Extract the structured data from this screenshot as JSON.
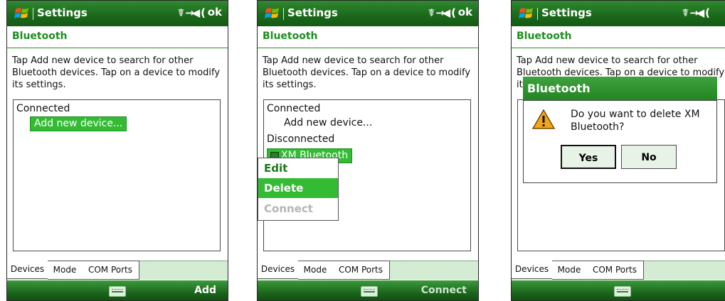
{
  "screens": [
    {
      "title": "Settings",
      "ok": "ok",
      "header": "Bluetooth",
      "intro": "Tap Add new device to search for other Bluetooth devices. Tap on a device to modify its settings.",
      "list": {
        "connected": "Connected",
        "add_new": "Add new device..."
      },
      "tabs": [
        "Devices",
        "Mode",
        "COM Ports"
      ],
      "softkey": "Add"
    },
    {
      "title": "Settings",
      "ok": "ok",
      "header": "Bluetooth",
      "intro": "Tap Add new device to search for other Bluetooth devices. Tap on a device to modify its settings.",
      "list": {
        "connected": "Connected",
        "add_new": "Add new device...",
        "disconnected": "Disconnected",
        "device": "XM Bluetooth"
      },
      "menu": [
        "Edit",
        "Delete",
        "Connect"
      ],
      "tabs": [
        "Devices",
        "Mode",
        "COM Ports"
      ],
      "softkey": "Connect"
    },
    {
      "title": "Settings",
      "header": "Bluetooth",
      "intro": "Tap Add new device to search for other Bluetooth devices. Tap on a device to modify its settings.",
      "dialog": {
        "title": "Bluetooth",
        "message": "Do you want to delete XM Bluetooth?",
        "yes": "Yes",
        "no": "No"
      },
      "tabs": [
        "Devices",
        "Mode",
        "COM Ports"
      ]
    }
  ],
  "colors": {
    "green": "#1d8f1d",
    "selection": "#33bb33",
    "warning": "#f3a51a"
  }
}
